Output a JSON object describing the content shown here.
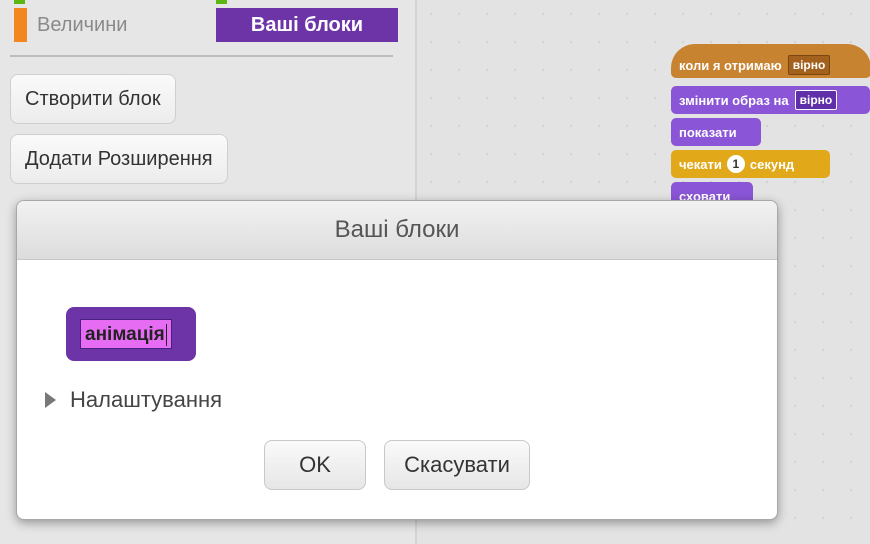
{
  "palette": {
    "categories": {
      "values": "Величини",
      "my_blocks": "Ваші блоки"
    },
    "buttons": {
      "make_block": "Створити блок",
      "add_extension": "Додати Розширення"
    }
  },
  "scripts": {
    "hat": {
      "label": "коли я отримаю",
      "field": "вірно"
    },
    "switch_costume": {
      "label": "змінити образ на",
      "field": "вірно"
    },
    "show": {
      "label": "показати"
    },
    "wait": {
      "label_before": "чекати",
      "value": "1",
      "label_after": "секунд"
    },
    "hide": {
      "label": "сховати"
    }
  },
  "dialog": {
    "title": "Ваші блоки",
    "block_name": "анімація",
    "options_label": "Налаштування",
    "ok_label": "OK",
    "cancel_label": "Скасувати"
  },
  "colors": {
    "my_blocks": "#6d34a8",
    "looks": "#8a55d7",
    "events": "#c88330",
    "control": "#e1a91a",
    "variables": "#f2871f"
  }
}
